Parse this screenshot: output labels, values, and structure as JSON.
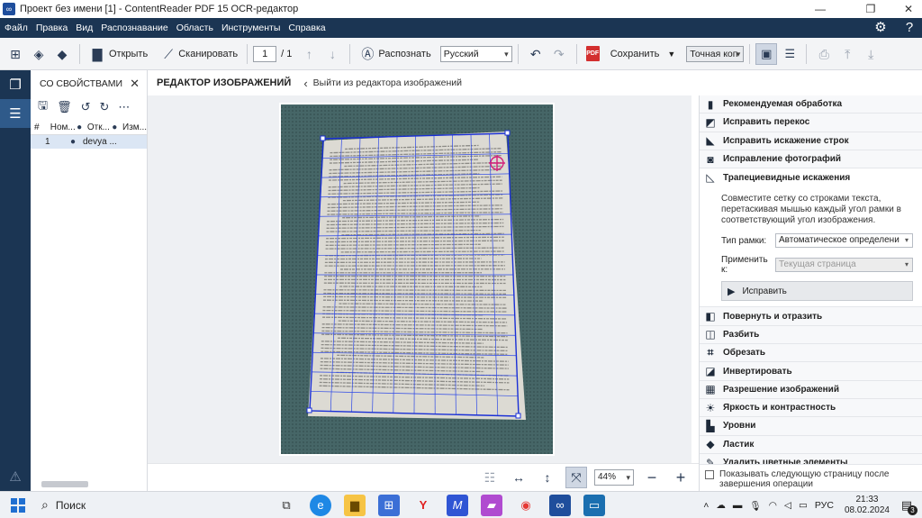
{
  "window": {
    "title": "Проект без имени [1] - ContentReader PDF 15 OCR-редактор",
    "icon": "contentreader-logo-icon",
    "minimize": "—",
    "restore": "❐",
    "close": "✕"
  },
  "menu": {
    "items": [
      "Файл",
      "Правка",
      "Вид",
      "Распознавание",
      "Область",
      "Инструменты",
      "Справка"
    ]
  },
  "toolbar": {
    "open_label": "Открыть",
    "scan_label": "Сканировать",
    "page_current": "1",
    "page_total": "/ 1",
    "recognize_label": "Распознать",
    "language": "Русский",
    "save_label": "Сохранить",
    "mode": "Точная коп",
    "pdf_badge": "PDF"
  },
  "left_panel": {
    "title": "СО СВОЙСТВАМИ",
    "columns": [
      "#",
      "Ном...",
      "Отк...",
      "Изм..."
    ],
    "rows": [
      {
        "num": "1",
        "name": "devya ..."
      }
    ]
  },
  "editor": {
    "title": "РЕДАКТОР ИЗОБРАЖЕНИЙ",
    "back_label": "Выйти из редактора изображений",
    "zoom": "44%"
  },
  "right_panel": {
    "tools": [
      {
        "label": "Рекомендуемая обработка",
        "icon": "recommended-icon"
      },
      {
        "label": "Исправить перекос",
        "icon": "deskew-icon"
      },
      {
        "label": "Исправить искажение строк",
        "icon": "straighten-lines-icon"
      },
      {
        "label": "Исправление фотографий",
        "icon": "camera-icon"
      },
      {
        "label": "Трапециевидные искажения",
        "icon": "trapezoid-icon"
      }
    ],
    "trapezoid": {
      "description": "Совместите сетку со строками текста, перетаскивая мышью каждый угол рамки в соответствующий угол изображения.",
      "frame_type_label": "Тип рамки:",
      "frame_type_value": "Автоматическое определени",
      "apply_to_label": "Применить к:",
      "apply_to_value": "Текущая страница",
      "apply_button": "Исправить"
    },
    "tools2": [
      {
        "label": "Повернуть и отразить",
        "icon": "rotate-icon"
      },
      {
        "label": "Разбить",
        "icon": "split-icon"
      },
      {
        "label": "Обрезать",
        "icon": "crop-icon"
      },
      {
        "label": "Инвертировать",
        "icon": "invert-icon"
      },
      {
        "label": "Разрешение изображений",
        "icon": "resolution-icon"
      },
      {
        "label": "Яркость и контрастность",
        "icon": "brightness-icon"
      },
      {
        "label": "Уровни",
        "icon": "levels-icon"
      },
      {
        "label": "Ластик",
        "icon": "eraser-icon"
      },
      {
        "label": "Удалить цветные элементы",
        "icon": "remove-color-icon"
      }
    ],
    "footer_checkbox": "Показывать следующую страницу после завершения операции"
  },
  "taskbar": {
    "search_label": "Поиск",
    "lang": "РУС",
    "time": "21:33",
    "date": "08.02.2024",
    "notif_count": "3"
  }
}
